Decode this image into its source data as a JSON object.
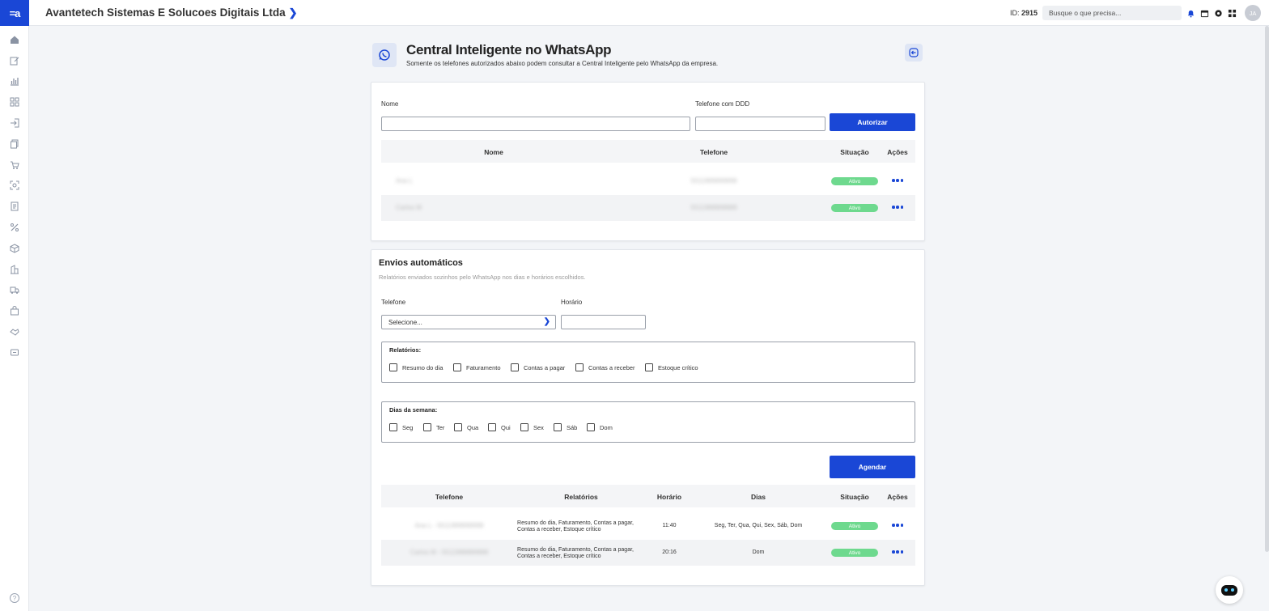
{
  "app": {
    "logo_text": "=a",
    "company_name": "Avantetech Sistemas E Solucoes Digitais Ltda",
    "id_label": "ID:",
    "id_value": "2915",
    "search_placeholder": "Busque o que precisa...",
    "avatar_initials": "JA",
    "brand_color": "#1a47d6"
  },
  "sidebar": {
    "icons": [
      "home-icon",
      "edit-icon",
      "chart-icon",
      "grid-icon",
      "login-icon",
      "copy-icon",
      "cart-icon",
      "scan-icon",
      "receipt-icon",
      "percent-icon",
      "box-icon",
      "building-icon",
      "truck-icon",
      "bag-icon",
      "handshake-icon",
      "support-icon"
    ],
    "help_label": "?"
  },
  "header": {
    "title": "Central Inteligente no WhatsApp",
    "subtitle": "Somente os telefones autorizados abaixo podem consultar a Central Inteligente pelo WhatsApp da empresa."
  },
  "authorize": {
    "name_label": "Nome",
    "name_value": "",
    "phone_label": "Telefone com DDD",
    "phone_value": "",
    "button_label": "Autorizar",
    "columns": [
      "Nome",
      "Telefone",
      "Situação",
      "Ações"
    ],
    "rows": [
      {
        "nome": "Ana L",
        "telefone": "5511999999999",
        "situacao": "Ativo"
      },
      {
        "nome": "Carlos M",
        "telefone": "5511988888888",
        "situacao": "Ativo"
      }
    ]
  },
  "auto": {
    "title": "Envios automáticos",
    "subtitle": "Relatórios enviados sozinhos pelo WhatsApp nos dias e horários escolhidos.",
    "phone_label": "Telefone",
    "phone_select": "Selecione...",
    "time_label": "Horário",
    "time_value": "",
    "reports_title": "Relatórios:",
    "reports": [
      "Resumo do dia",
      "Faturamento",
      "Contas a pagar",
      "Contas a receber",
      "Estoque crítico"
    ],
    "days_title": "Dias da semana:",
    "days": [
      "Seg",
      "Ter",
      "Qua",
      "Qui",
      "Sex",
      "Sáb",
      "Dom"
    ],
    "button_label": "Agendar",
    "columns": [
      "Telefone",
      "Relatórios",
      "Horário",
      "Dias",
      "Situação",
      "Ações"
    ],
    "rows": [
      {
        "telefone": "Ana L - 5511999999999",
        "relatorios_1": "Resumo do dia, Faturamento, Contas a pagar,",
        "relatorios_2": "Contas a receber, Estoque crítico",
        "horario": "11:40",
        "dias": "Seg, Ter, Qua, Qui, Sex, Sáb, Dom",
        "situacao": "Ativo"
      },
      {
        "telefone": "Carlos M - 5511988888888",
        "relatorios_1": "Resumo do dia, Faturamento, Contas a pagar,",
        "relatorios_2": "Contas a receber, Estoque crítico",
        "horario": "20:16",
        "dias": "Dom",
        "situacao": "Ativo"
      }
    ]
  }
}
